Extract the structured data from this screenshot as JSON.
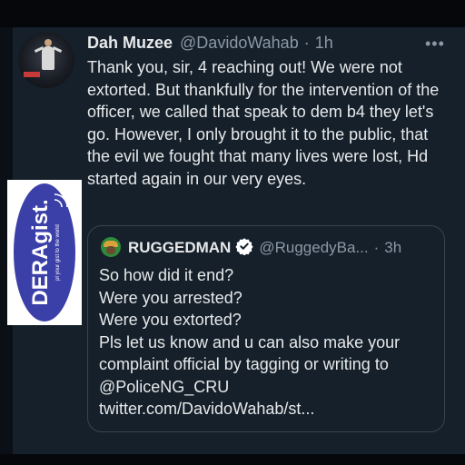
{
  "tweet": {
    "display_name": "Dah Muzee",
    "handle": "@DavidoWahab",
    "separator": "·",
    "time": "1h",
    "more_icon": "more-dots-icon",
    "text": "Thank you, sir, 4 reaching out! We were not extorted. But thankfully for the intervention of the officer, we called that speak to dem b4 they let's go. However, I only brought it to the public, that the evil we fought that many lives were lost, Hd started again in our very eyes."
  },
  "watermark": {
    "brand": "DERAgist.",
    "tagline": "pl your gist to the world"
  },
  "quoted": {
    "display_name": "RUGGEDMAN",
    "verified": true,
    "handle": "@RuggedyBa...",
    "separator": "·",
    "time": "3h",
    "lines": [
      "So how did it end?",
      "Were you arrested?",
      "Were you extorted?",
      "Pls let us know and u can also make your",
      "complaint official by tagging or writing to",
      "@PoliceNG_CRU",
      "twitter.com/DavidoWahab/st..."
    ]
  },
  "colors": {
    "background": "#15202b",
    "text": "#e7e9ea",
    "muted": "#8b98a5",
    "verified": "#ffffff",
    "logo_blue": "#3b3fa8"
  }
}
